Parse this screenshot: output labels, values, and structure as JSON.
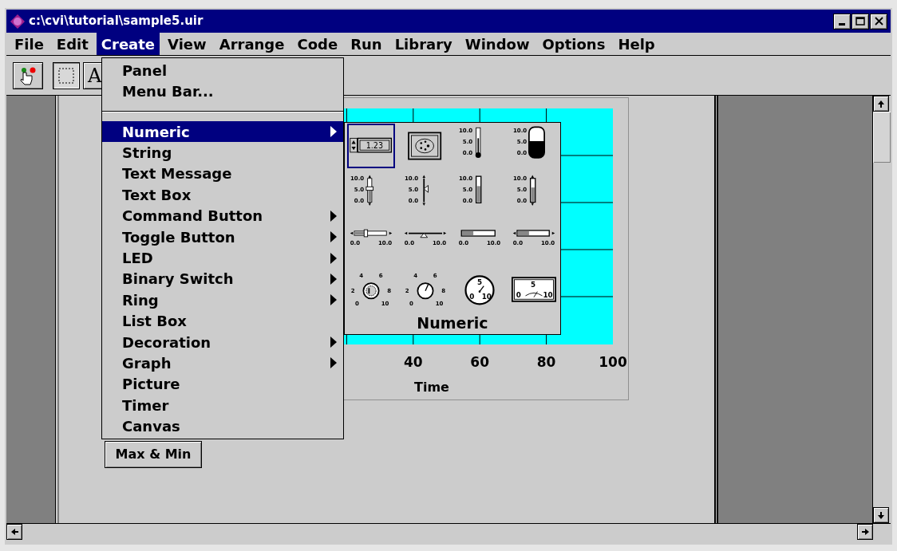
{
  "window": {
    "title": "c:\\cvi\\tutorial\\sample5.uir"
  },
  "menu_bar": [
    {
      "label": "File",
      "selected": false
    },
    {
      "label": "Edit",
      "selected": false
    },
    {
      "label": "Create",
      "selected": true
    },
    {
      "label": "View",
      "selected": false
    },
    {
      "label": "Arrange",
      "selected": false
    },
    {
      "label": "Code",
      "selected": false
    },
    {
      "label": "Run",
      "selected": false
    },
    {
      "label": "Library",
      "selected": false
    },
    {
      "label": "Window",
      "selected": false
    },
    {
      "label": "Options",
      "selected": false
    },
    {
      "label": "Help",
      "selected": false
    }
  ],
  "toolbar": [
    {
      "kind": "operate",
      "selected": false
    },
    {
      "kind": "select",
      "selected": true
    },
    {
      "kind": "text",
      "label": "A",
      "selected": false
    }
  ],
  "create_menu": {
    "top_items": [
      {
        "label": "Panel"
      },
      {
        "label": "Menu Bar..."
      }
    ],
    "items": [
      {
        "label": "Numeric",
        "submenu": true,
        "selected": true
      },
      {
        "label": "String",
        "submenu": false,
        "selected": false
      },
      {
        "label": "Text Message",
        "submenu": false,
        "selected": false
      },
      {
        "label": "Text Box",
        "submenu": false,
        "selected": false
      },
      {
        "label": "Command Button",
        "submenu": true,
        "selected": false
      },
      {
        "label": "Toggle Button",
        "submenu": true,
        "selected": false
      },
      {
        "label": "LED",
        "submenu": true,
        "selected": false
      },
      {
        "label": "Binary Switch",
        "submenu": true,
        "selected": false
      },
      {
        "label": "Ring",
        "submenu": true,
        "selected": false
      },
      {
        "label": "List Box",
        "submenu": false,
        "selected": false
      },
      {
        "label": "Decoration",
        "submenu": true,
        "selected": false
      },
      {
        "label": "Graph",
        "submenu": true,
        "selected": false
      },
      {
        "label": "Picture",
        "submenu": false,
        "selected": false
      },
      {
        "label": "Timer",
        "submenu": false,
        "selected": false
      },
      {
        "label": "Canvas",
        "submenu": false,
        "selected": false
      }
    ]
  },
  "numeric_palette": {
    "caption": "Numeric",
    "controls": [
      {
        "kind": "numeric",
        "value": "1.23",
        "selected": true
      },
      {
        "kind": "color",
        "selected": false
      },
      {
        "kind": "thermometer",
        "scale": [
          "10.0",
          "5.0",
          "0.0"
        ],
        "selected": false
      },
      {
        "kind": "tank",
        "scale": [
          "10.0",
          "5.0",
          "0.0"
        ],
        "selected": false
      },
      {
        "kind": "vslide",
        "scale": [
          "10.0",
          "5.0",
          "0.0"
        ],
        "selected": false
      },
      {
        "kind": "vpointer",
        "scale": [
          "10.0",
          "5.0",
          "0.0"
        ],
        "selected": false
      },
      {
        "kind": "vfill",
        "scale": [
          "10.0",
          "5.0",
          "0.0"
        ],
        "selected": false
      },
      {
        "kind": "vfill_arrows",
        "scale": [
          "10.0",
          "5.0",
          "0.0"
        ],
        "selected": false
      },
      {
        "kind": "hslide",
        "scale": [
          "0.0",
          "10.0"
        ],
        "selected": false
      },
      {
        "kind": "hpointer",
        "scale": [
          "0.0",
          "10.0"
        ],
        "selected": false
      },
      {
        "kind": "hfill",
        "scale": [
          "0.0",
          "10.0"
        ],
        "selected": false
      },
      {
        "kind": "hfill_arrows",
        "scale": [
          "0.0",
          "10.0"
        ],
        "selected": false
      },
      {
        "kind": "knob",
        "scale": [
          "0",
          "2",
          "4",
          "6",
          "8",
          "10"
        ],
        "selected": false
      },
      {
        "kind": "dial",
        "scale": [
          "0",
          "2",
          "4",
          "6",
          "8",
          "10"
        ],
        "selected": false
      },
      {
        "kind": "gauge",
        "scale": [
          "0",
          "5",
          "10"
        ],
        "selected": false
      },
      {
        "kind": "meter",
        "scale": [
          "0",
          "5",
          "10"
        ],
        "selected": false
      }
    ]
  },
  "panel": {
    "graph": {
      "x_ticks": [
        "40",
        "60",
        "80",
        "100"
      ],
      "xlabel": "Time"
    },
    "buttons": [
      {
        "label": "Max & Min"
      }
    ]
  }
}
